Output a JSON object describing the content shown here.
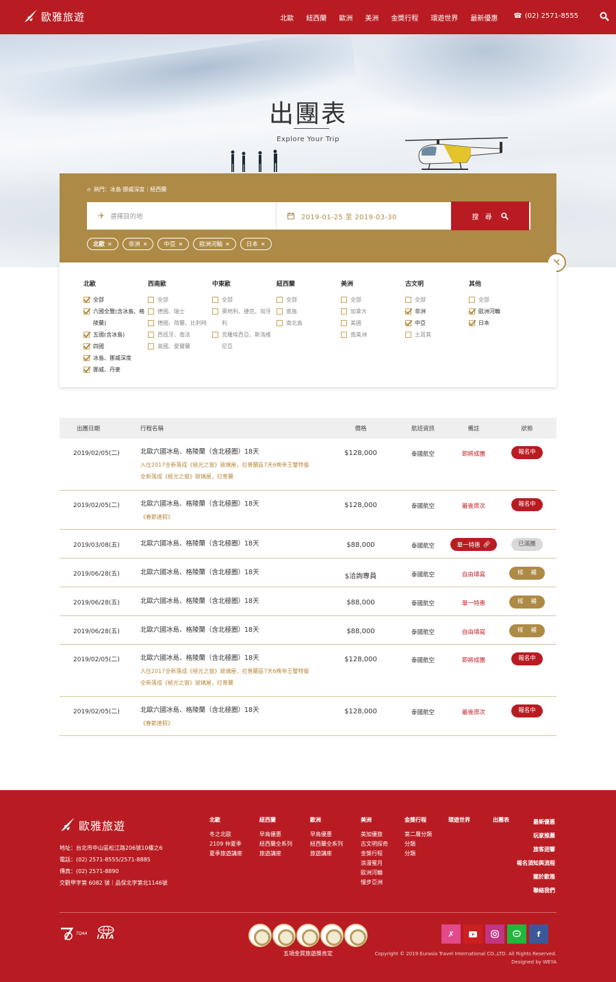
{
  "header": {
    "brand": "歐雅旅遊",
    "nav": [
      "北歐",
      "紐西蘭",
      "歐洲",
      "美洲",
      "金獎行程",
      "環遊世界",
      "最新優惠"
    ],
    "phone": "(02) 2571-8555"
  },
  "hero": {
    "title": "出團表",
    "subtitle": "Explore Your Trip"
  },
  "search": {
    "hot_label": "熱門：冰島·挪威深度｜紐西蘭",
    "destination_placeholder": "選擇目的地",
    "date_range": "2019-01-25 至 2019-03-30",
    "button_label": "搜 尋",
    "chips": [
      {
        "label": "北歐",
        "selected": true
      },
      {
        "label": "非洲",
        "selected": false
      },
      {
        "label": "中亞",
        "selected": false
      },
      {
        "label": "歐洲河輪",
        "selected": false
      },
      {
        "label": "日本",
        "selected": false
      }
    ]
  },
  "filters": [
    {
      "title": "北歐",
      "options": [
        {
          "label": "全部",
          "checked": true
        },
        {
          "label": "六國全覽(含冰島、格陵蘭)",
          "checked": true
        },
        {
          "label": "五國(含冰島)",
          "checked": true
        },
        {
          "label": "四國",
          "checked": true
        },
        {
          "label": "冰島、挪威深度",
          "checked": true
        },
        {
          "label": "挪威、丹麥",
          "checked": true
        }
      ]
    },
    {
      "title": "西南歐",
      "options": [
        {
          "label": "全部",
          "checked": false
        },
        {
          "label": "德國、瑞士",
          "checked": false
        },
        {
          "label": "德國、荷蘭、比利時",
          "checked": false
        },
        {
          "label": "西班牙、南法",
          "checked": false
        },
        {
          "label": "英國、愛爾蘭",
          "checked": false
        }
      ]
    },
    {
      "title": "中東歐",
      "options": [
        {
          "label": "全部",
          "checked": false
        },
        {
          "label": "奧地利、捷克、匈牙利",
          "checked": false
        },
        {
          "label": "克羅埃西亞、斯洛維尼亞",
          "checked": false
        }
      ]
    },
    {
      "title": "紐西蘭",
      "options": [
        {
          "label": "全部",
          "checked": false
        },
        {
          "label": "南島",
          "checked": false
        },
        {
          "label": "南北島",
          "checked": false
        }
      ]
    },
    {
      "title": "美洲",
      "options": [
        {
          "label": "全部",
          "checked": false
        },
        {
          "label": "加拿大",
          "checked": false
        },
        {
          "label": "美國",
          "checked": false
        },
        {
          "label": "南美洲",
          "checked": false
        }
      ]
    },
    {
      "title": "古文明",
      "options": [
        {
          "label": "全部",
          "checked": false
        },
        {
          "label": "非洲",
          "checked": true
        },
        {
          "label": "中亞",
          "checked": true
        },
        {
          "label": "土耳其",
          "checked": false
        }
      ]
    },
    {
      "title": "其他",
      "options": [
        {
          "label": "全部",
          "checked": false
        },
        {
          "label": "歐洲河輪",
          "checked": true
        },
        {
          "label": "日本",
          "checked": true
        }
      ]
    }
  ],
  "table": {
    "headers": [
      "出團日期",
      "行程名稱",
      "價格",
      "航班資訊",
      "備註",
      "狀態"
    ],
    "rows": [
      {
        "date": "2019/02/05(二)",
        "name": "北歐六國冰島、格陵蘭（含北極圈）18天",
        "notes": [
          "入住2017全新落成《極光之窗》玻璃屋，拉普蘭區7天6晚帝王蟹特餐",
          "全新落成《極光之窗》玻璃屋，拉普蘭"
        ],
        "price": "$128,000",
        "flight": "泰國航空",
        "remark": "即將成團",
        "remark_type": "text",
        "status": "報名中",
        "status_type": "red"
      },
      {
        "date": "2019/02/05(二)",
        "name": "北歐六國冰島、格陵蘭（含北極圈）18天",
        "notes": [
          "《春節連假》"
        ],
        "price": "$128,000",
        "flight": "泰國航空",
        "remark": "最後席次",
        "remark_type": "text",
        "status": "報名中",
        "status_type": "red"
      },
      {
        "date": "2019/03/08(五)",
        "name": "北歐六國冰島、格陵蘭（含北極圈）18天",
        "notes": [],
        "price": "$88,000",
        "flight": "泰國航空",
        "remark": "單一特惠",
        "remark_type": "promo",
        "status": "已滿團",
        "status_type": "gray"
      },
      {
        "date": "2019/06/28(五)",
        "name": "北歐六國冰島、格陵蘭（含北極圈）18天",
        "notes": [],
        "price": "$洽詢專員",
        "flight": "泰國航空",
        "remark": "自由填寫",
        "remark_type": "text",
        "status": "候 補",
        "status_type": "gold"
      },
      {
        "date": "2019/06/28(五)",
        "name": "北歐六國冰島、格陵蘭（含北極圈）18天",
        "notes": [],
        "price": "$88,000",
        "flight": "泰國航空",
        "remark": "單一特惠",
        "remark_type": "text",
        "status": "候 補",
        "status_type": "gold"
      },
      {
        "date": "2019/06/28(五)",
        "name": "北歐六國冰島、格陵蘭（含北極圈）18天",
        "notes": [],
        "price": "$88,000",
        "flight": "泰國航空",
        "remark": "自由填寫",
        "remark_type": "text",
        "status": "候 補",
        "status_type": "gold"
      },
      {
        "date": "2019/02/05(二)",
        "name": "北歐六國冰島、格陵蘭（含北極圈）18天",
        "notes": [
          "入住2017全新落成《極光之窗》玻璃屋，拉普蘭區7天6晚帝王蟹特餐",
          "全新落成《極光之窗》玻璃屋，拉普蘭"
        ],
        "price": "$128,000",
        "flight": "泰國航空",
        "remark": "即將成團",
        "remark_type": "text",
        "status": "報名中",
        "status_type": "red"
      },
      {
        "date": "2019/02/05(二)",
        "name": "北歐六國冰島、格陵蘭（含北極圈）18天",
        "notes": [
          "《春節連假》"
        ],
        "price": "$128,000",
        "flight": "泰國航空",
        "remark": "最後席次",
        "remark_type": "text",
        "status": "報名中",
        "status_type": "red"
      }
    ]
  },
  "footer": {
    "brand": "歐雅旅遊",
    "address": [
      "地址：台北市中山區松江路206號10樓之6",
      "電話：(02) 2571-8555/2571-8885",
      "傳真：(02) 2571-8890",
      "交觀甲字第 6082 號｜品保北字第北1146號"
    ],
    "columns": [
      {
        "title": "北歐",
        "items": [
          "冬之北歐",
          "2109 仲夏季",
          "夏季旅遊講座"
        ]
      },
      {
        "title": "紐西蘭",
        "items": [
          "早鳥優惠",
          "紐西蘭全系列",
          "旅遊講座"
        ]
      },
      {
        "title": "歐洲",
        "items": [
          "早鳥優惠",
          "紐西蘭全系列",
          "旅遊講座"
        ]
      },
      {
        "title": "美洲",
        "items": [
          "美加優旅",
          "古文明探奇",
          "金獎行程",
          "浪漫蜜月",
          "歐洲河輪",
          "慢步亞洲"
        ]
      },
      {
        "title": "金獎行程",
        "items": [
          "第二層分類",
          "分類",
          "分類"
        ]
      },
      {
        "title": "環遊世界",
        "items": []
      },
      {
        "title": "出團表",
        "items": []
      }
    ],
    "right_links": [
      "最新優惠",
      "玩家推薦",
      "旅客迴響",
      "報名須知與流程",
      "關於歐雅",
      "聯絡我們"
    ],
    "orgs": [
      "TQAA",
      "IATA"
    ],
    "award_text": "五項金質旅遊獎肯定",
    "copyright": "Copyright © 2019 Eurasia Travel International CO.,LTD. All Rights Reserved.",
    "designer": "Designed by WEYA",
    "social_colors": {
      "pixnet": "#e24a8b",
      "youtube": "#cc1f1f",
      "instagram": "#c13584",
      "line": "#1fb83c",
      "facebook": "#3b5998"
    }
  }
}
